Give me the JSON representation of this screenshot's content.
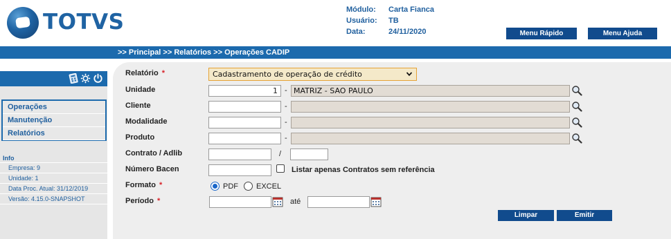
{
  "brand": {
    "name": "TOTVS"
  },
  "header": {
    "modulo_label": "Módulo:",
    "modulo_value": "Carta Fianca",
    "usuario_label": "Usuário:",
    "usuario_value": "TB",
    "data_label": "Data:",
    "data_value": "24/11/2020",
    "menu_rapido": "Menu Rápido",
    "menu_ajuda": "Menu Ajuda"
  },
  "breadcrumb": ">> Principal >> Relatórios >> Operações CADIP",
  "sidebar": {
    "icons": [
      "calculator-icon",
      "gear-icon",
      "power-icon"
    ],
    "menu": [
      "Operações",
      "Manutenção",
      "Relatórios"
    ],
    "info_title": "Info",
    "info_lines": [
      "Empresa: 9",
      "Unidade: 1",
      "Data Proc. Atual: 31/12/2019",
      "Versão: 4.15.0-SNAPSHOT"
    ]
  },
  "form": {
    "relatorio": {
      "label": "Relatório",
      "required": "*",
      "value": "Cadastramento de operação de crédito"
    },
    "unidade": {
      "label": "Unidade",
      "code": "1",
      "dash": "-",
      "description": "MATRIZ - SAO PAULO"
    },
    "cliente": {
      "label": "Cliente",
      "code": "",
      "dash": "-",
      "description": ""
    },
    "modalidade": {
      "label": "Modalidade",
      "code": "",
      "dash": "-",
      "description": ""
    },
    "produto": {
      "label": "Produto",
      "code": "",
      "dash": "-",
      "description": ""
    },
    "contrato": {
      "label": "Contrato / Adlib",
      "separator": "/",
      "value1": "",
      "value2": ""
    },
    "numero_bacen": {
      "label": "Número Bacen",
      "value": "",
      "checkbox_label": "Listar apenas Contratos sem referência"
    },
    "formato": {
      "label": "Formato",
      "required": "*",
      "option_pdf": "PDF",
      "option_excel": "EXCEL",
      "selected": "PDF"
    },
    "periodo": {
      "label": "Período",
      "required": "*",
      "from": "",
      "to_label": "até",
      "to": ""
    }
  },
  "actions": {
    "limpar": "Limpar",
    "emitir": "Emitir"
  },
  "colors": {
    "primary_blue": "#1c6aad",
    "button_blue": "#114b8d",
    "required_red": "#d8232a",
    "desc_field_bg": "#e2dcd4"
  }
}
